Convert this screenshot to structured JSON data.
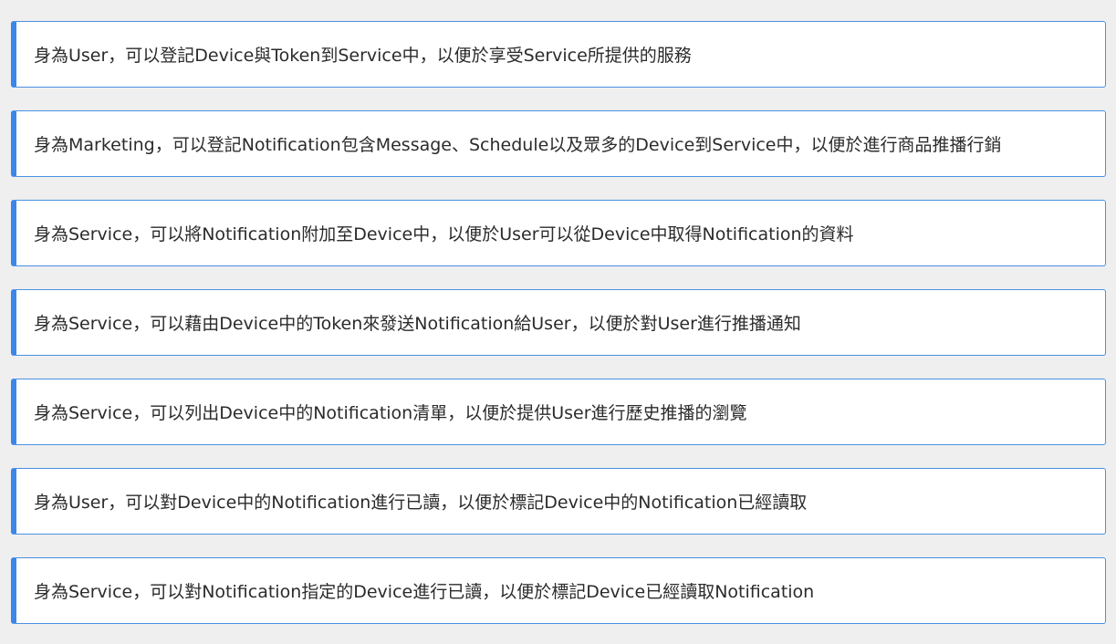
{
  "stories": [
    {
      "text": "身為User，可以登記Device與Token到Service中，以便於享受Service所提供的服務"
    },
    {
      "text": "身為Marketing，可以登記Notification包含Message、Schedule以及眾多的Device到Service中，以便於進行商品推播行銷"
    },
    {
      "text": "身為Service，可以將Notification附加至Device中，以便於User可以從Device中取得Notification的資料"
    },
    {
      "text": "身為Service，可以藉由Device中的Token來發送Notification給User，以便於對User進行推播通知"
    },
    {
      "text": "身為Service，可以列出Device中的Notification清單，以便於提供User進行歷史推播的瀏覽"
    },
    {
      "text": "身為User，可以對Device中的Notification進行已讀，以便於標記Device中的Notification已經讀取"
    },
    {
      "text": "身為Service，可以對Notification指定的Device進行已讀，以便於標記Device已經讀取Notification"
    }
  ],
  "colors": {
    "background": "#efefef",
    "card_background": "#ffffff",
    "accent": "#3b86e8",
    "border": "#4a90e2",
    "text": "#2b2b2b"
  }
}
